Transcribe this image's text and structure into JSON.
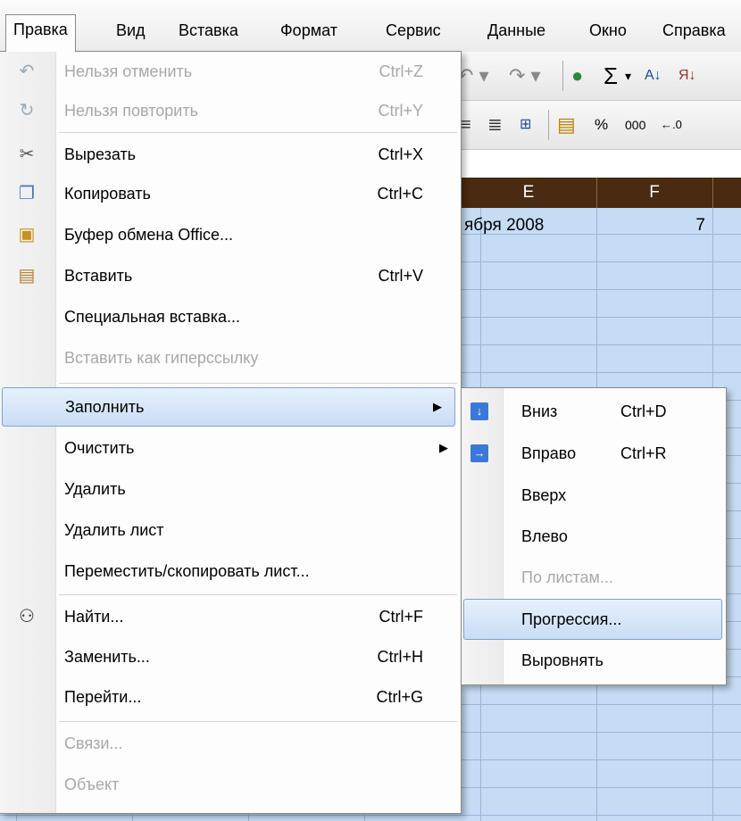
{
  "menubar": {
    "items": [
      {
        "label": "Правка"
      },
      {
        "label": "Вид"
      },
      {
        "label": "Вставка"
      },
      {
        "label": "Формат"
      },
      {
        "label": "Сервис"
      },
      {
        "label": "Данные"
      },
      {
        "label": "Окно"
      },
      {
        "label": "Справка"
      }
    ]
  },
  "toolbar": {
    "sum_symbol": "Σ",
    "percent": "%",
    "thousands": "000"
  },
  "sheet": {
    "columns": [
      "E",
      "F"
    ],
    "cell_e1": "ября 2008",
    "cell_f1": "7",
    "highlight_color": "#c6dcf4",
    "header_color": "#4a2a10"
  },
  "edit_menu": {
    "items": [
      {
        "label": "Нельзя отменить",
        "shortcut": "Ctrl+Z",
        "icon": "undo-icon",
        "enabled": false
      },
      {
        "label": "Нельзя повторить",
        "shortcut": "Ctrl+Y",
        "icon": "redo-icon",
        "enabled": false
      },
      {
        "label": "Вырезать",
        "shortcut": "Ctrl+X",
        "icon": "scissors-icon",
        "enabled": true
      },
      {
        "label": "Копировать",
        "shortcut": "Ctrl+C",
        "icon": "copy-icon",
        "enabled": true
      },
      {
        "label": "Буфер обмена Office...",
        "shortcut": "",
        "icon": "clipboard-office-icon",
        "enabled": true
      },
      {
        "label": "Вставить",
        "shortcut": "Ctrl+V",
        "icon": "paste-icon",
        "enabled": true
      },
      {
        "label": "Специальная вставка...",
        "shortcut": "",
        "enabled": true
      },
      {
        "label": "Вставить как гиперссылку",
        "shortcut": "",
        "enabled": false
      },
      {
        "label": "Заполнить",
        "shortcut": "",
        "submenu": true,
        "highlighted": true,
        "enabled": true
      },
      {
        "label": "Очистить",
        "shortcut": "",
        "submenu": true,
        "enabled": true
      },
      {
        "label": "Удалить",
        "shortcut": "",
        "enabled": true
      },
      {
        "label": "Удалить лист",
        "shortcut": "",
        "enabled": true
      },
      {
        "label": "Переместить/скопировать лист...",
        "shortcut": "",
        "enabled": true
      },
      {
        "label": "Найти...",
        "shortcut": "Ctrl+F",
        "icon": "binoculars-icon",
        "enabled": true
      },
      {
        "label": "Заменить...",
        "shortcut": "Ctrl+H",
        "enabled": true
      },
      {
        "label": "Перейти...",
        "shortcut": "Ctrl+G",
        "enabled": true
      },
      {
        "label": "Связи...",
        "shortcut": "",
        "enabled": false
      },
      {
        "label": "Объект",
        "shortcut": "",
        "enabled": false
      }
    ]
  },
  "fill_submenu": {
    "items": [
      {
        "label": "Вниз",
        "shortcut": "Ctrl+D",
        "icon": "fill-down-icon",
        "enabled": true
      },
      {
        "label": "Вправо",
        "shortcut": "Ctrl+R",
        "icon": "fill-right-icon",
        "enabled": true
      },
      {
        "label": "Вверх",
        "shortcut": "",
        "enabled": true
      },
      {
        "label": "Влево",
        "shortcut": "",
        "enabled": true
      },
      {
        "label": "По листам...",
        "shortcut": "",
        "enabled": false
      },
      {
        "label": "Прогрессия...",
        "shortcut": "",
        "highlighted": true,
        "enabled": true
      },
      {
        "label": "Выровнять",
        "shortcut": "",
        "enabled": true
      }
    ]
  }
}
